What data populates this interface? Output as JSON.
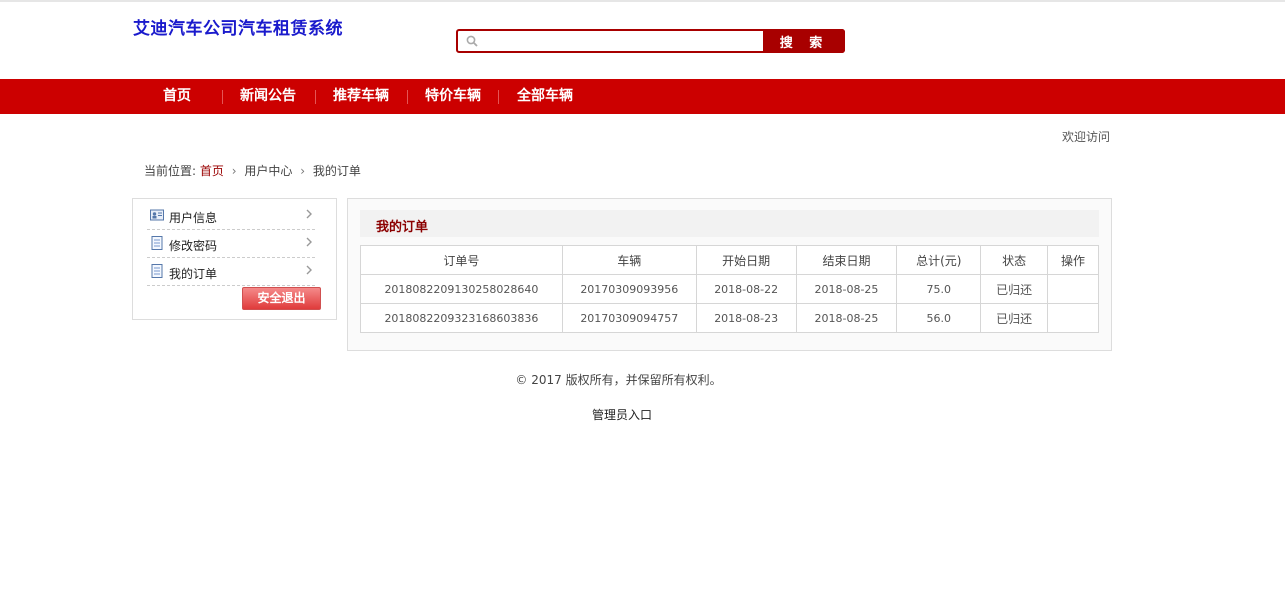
{
  "site": {
    "title": "艾迪汽车公司汽车租赁系统"
  },
  "search": {
    "placeholder": "",
    "value": "",
    "button_label": "搜 索"
  },
  "nav": {
    "items": [
      {
        "label": "首页"
      },
      {
        "label": "新闻公告"
      },
      {
        "label": "推荐车辆"
      },
      {
        "label": "特价车辆"
      },
      {
        "label": "全部车辆"
      }
    ]
  },
  "header": {
    "welcome": "欢迎访问"
  },
  "breadcrumb": {
    "prefix": "当前位置:",
    "home": "首页",
    "items": [
      "用户中心",
      "我的订单"
    ]
  },
  "sidebar": {
    "items": [
      {
        "label": "用户信息",
        "icon": "user-card-icon"
      },
      {
        "label": "修改密码",
        "icon": "document-icon"
      },
      {
        "label": "我的订单",
        "icon": "document-icon"
      }
    ],
    "logout_label": "安全退出"
  },
  "orders": {
    "title": "我的订单",
    "columns": [
      "订单号",
      "车辆",
      "开始日期",
      "结束日期",
      "总计(元)",
      "状态",
      "操作"
    ],
    "rows": [
      [
        "20180822091302580286​40",
        "20170309093956",
        "2018-08-22",
        "2018-08-25",
        "75.0",
        "已归还",
        ""
      ],
      [
        "2018082209323168603836",
        "20170309094757",
        "2018-08-23",
        "2018-08-25",
        "56.0",
        "已归还",
        ""
      ]
    ]
  },
  "footer": {
    "copyright": "© 2017 版权所有，并保留所有权利。",
    "admin_link": "管理员入口"
  },
  "colors": {
    "brand_red": "#cc0000",
    "dark_red": "#a80000",
    "title_blue": "#1a1acc"
  }
}
